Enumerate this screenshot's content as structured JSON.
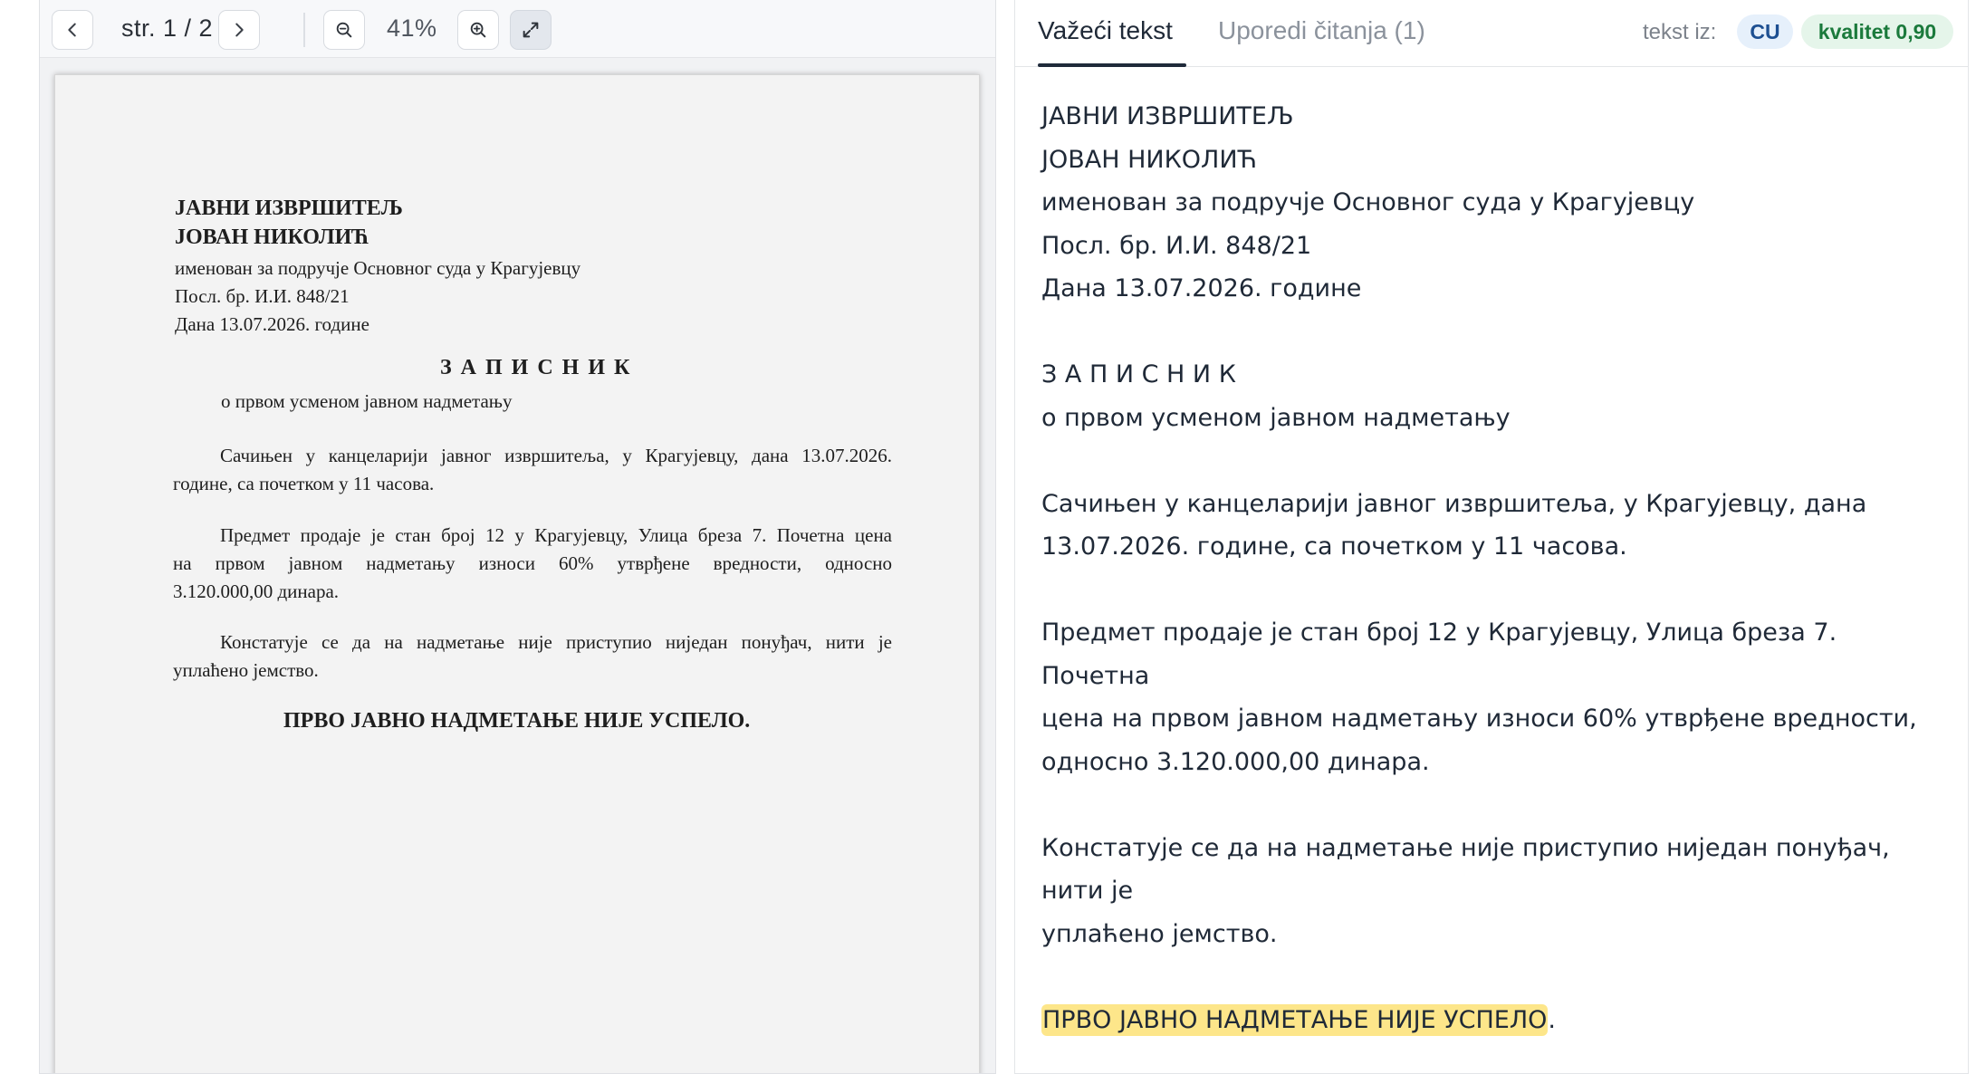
{
  "viewer": {
    "page_indicator": "str. 1 / 2",
    "zoom": "41%"
  },
  "scan": {
    "line1": "ЈАВНИ ИЗВРШИТЕЉ",
    "line2": "ЈОВАН НИКОЛИЋ",
    "line3": "именован за подручје Основног суда у Крагујевцу",
    "line4": "Посл. бр. И.И. 848/21",
    "line5": "Дана 13.07.2026. године",
    "title": "З А П И С Н И К",
    "subtitle": "о првом усменом јавном надметању",
    "p1a": "Сачињен у канцеларији јавног извршитеља, у Крагујевцу, дана 13.07.2026.",
    "p1b": "године, са почетком у 11 часова.",
    "p2a": "Предмет продаје је стан број 12 у Крагујевцу, Улица бреза 7. Почетна цена",
    "p2b": "на првом јавном надметању износи 60% утврђене вредности, односно",
    "p2c": "3.120.000,00 динара.",
    "p3a": "Констатује се да на надметање није приступио ниједан понуђач, нити је",
    "p3b": "уплаћено јемство.",
    "conclusion": "ПРВО ЈАВНО НАДМЕТАЊЕ НИЈЕ УСПЕЛО."
  },
  "panel": {
    "tab_active": "Važeći tekst",
    "tab_compare": "Uporedi čitanja (1)",
    "source_label": "tekst iz:",
    "source_badge": "CU",
    "quality_badge": "kvalitet 0,90"
  },
  "transcript": {
    "l1": "ЈАВНИ ИЗВРШИТЕЉ",
    "l2": "ЈОВАН НИКОЛИЋ",
    "l3": "именован за подручје Основног суда у Крагујевцу",
    "l4": "Посл. бр. И.И. 848/21",
    "l5": "Дана 13.07.2026. године",
    "l6": "З А П И С Н И К",
    "l7": "о првом усменом јавном надметању",
    "l8": "Сачињен у канцеларији јавног извршитеља, у Крагујевцу, дана",
    "l9": "13.07.2026. године, са почетком у 11 часова.",
    "l10": "Предмет продаје је стан број 12 у Крагујевцу, Улица бреза 7. Почетна",
    "l11": "цена на првом јавном надметању износи 60% утврђене вредности,",
    "l12": "односно 3.120.000,00 динара.",
    "l13": "Констатује се да на надметање није приступио ниједан понуђач, нити је",
    "l14": "уплаћено јемство.",
    "highlighted": "ПРВО ЈАВНО НАДМЕТАЊЕ НИЈЕ УСПЕЛО",
    "trailing": "."
  },
  "colors": {
    "highlight": "#fde68a",
    "cu_badge_bg": "#e6f0fb",
    "quality_badge_bg": "#e5f5ea"
  }
}
